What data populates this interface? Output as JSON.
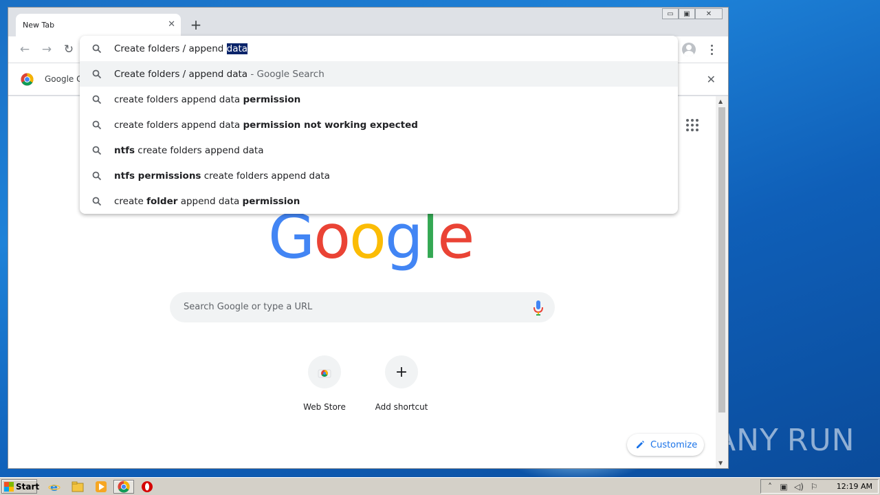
{
  "browser": {
    "tab_title": "New Tab",
    "tab_close_glyph": "✕",
    "new_tab_glyph": "+",
    "back_glyph": "←",
    "forward_glyph": "→",
    "reload_glyph": "↻",
    "window_min": "▭",
    "window_max": "▣",
    "window_close": "✕"
  },
  "infobar": {
    "text": "Google Cl",
    "close_glyph": "✕"
  },
  "omnibox": {
    "input_prefix": "Create folders / append ",
    "input_selected": "data",
    "suggestions": [
      {
        "plain": "Create folders / append data",
        "dim": " - Google Search"
      },
      {
        "plain": "create folders append data ",
        "bold": "permission"
      },
      {
        "plain": "create folders append data ",
        "bold": "permission not working expected"
      },
      {
        "bold_prefix": "ntfs",
        "plain": " create folders append data"
      },
      {
        "bold_prefix": "ntfs permissions",
        "plain": " create folders append data"
      },
      {
        "plain": "create ",
        "bold": "folder",
        "plain2": " append data ",
        "bold2": "permission"
      }
    ]
  },
  "newtab": {
    "logo_letters": [
      "G",
      "o",
      "o",
      "g",
      "l",
      "e"
    ],
    "logo_colors": [
      "#4285f4",
      "#ea4335",
      "#fbbc05",
      "#4285f4",
      "#34a853",
      "#ea4335"
    ],
    "search_placeholder": "Search Google or type a URL",
    "shortcuts": [
      {
        "label": "Web Store"
      },
      {
        "label": "Add shortcut",
        "glyph": "+"
      }
    ],
    "customize_label": "Customize"
  },
  "taskbar": {
    "start_label": "Start",
    "clock": "12:19 AM"
  },
  "watermark": {
    "left": "ANY",
    "right": "RUN"
  }
}
